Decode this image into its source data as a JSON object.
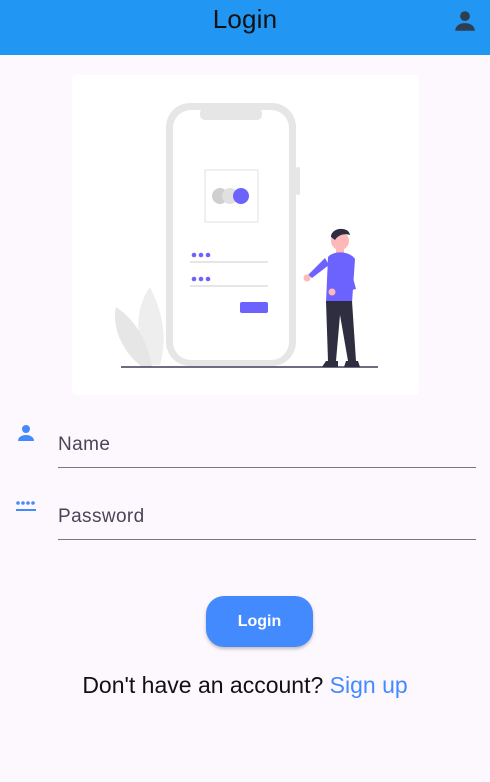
{
  "appbar": {
    "title": "Login",
    "account_icon": "person-icon",
    "background_color": "#2196f3"
  },
  "illustration": {
    "name": "phone-login-illustration",
    "accent_color": "#6c63ff"
  },
  "form": {
    "name_field": {
      "placeholder": "Name",
      "value": "",
      "icon": "person-icon"
    },
    "password_field": {
      "placeholder": "Password",
      "value": "",
      "icon": "password-dots-icon"
    },
    "submit_label": "Login",
    "accent_color": "#448aff"
  },
  "signup": {
    "prompt": "Don't have an account? ",
    "link_label": "Sign up"
  }
}
